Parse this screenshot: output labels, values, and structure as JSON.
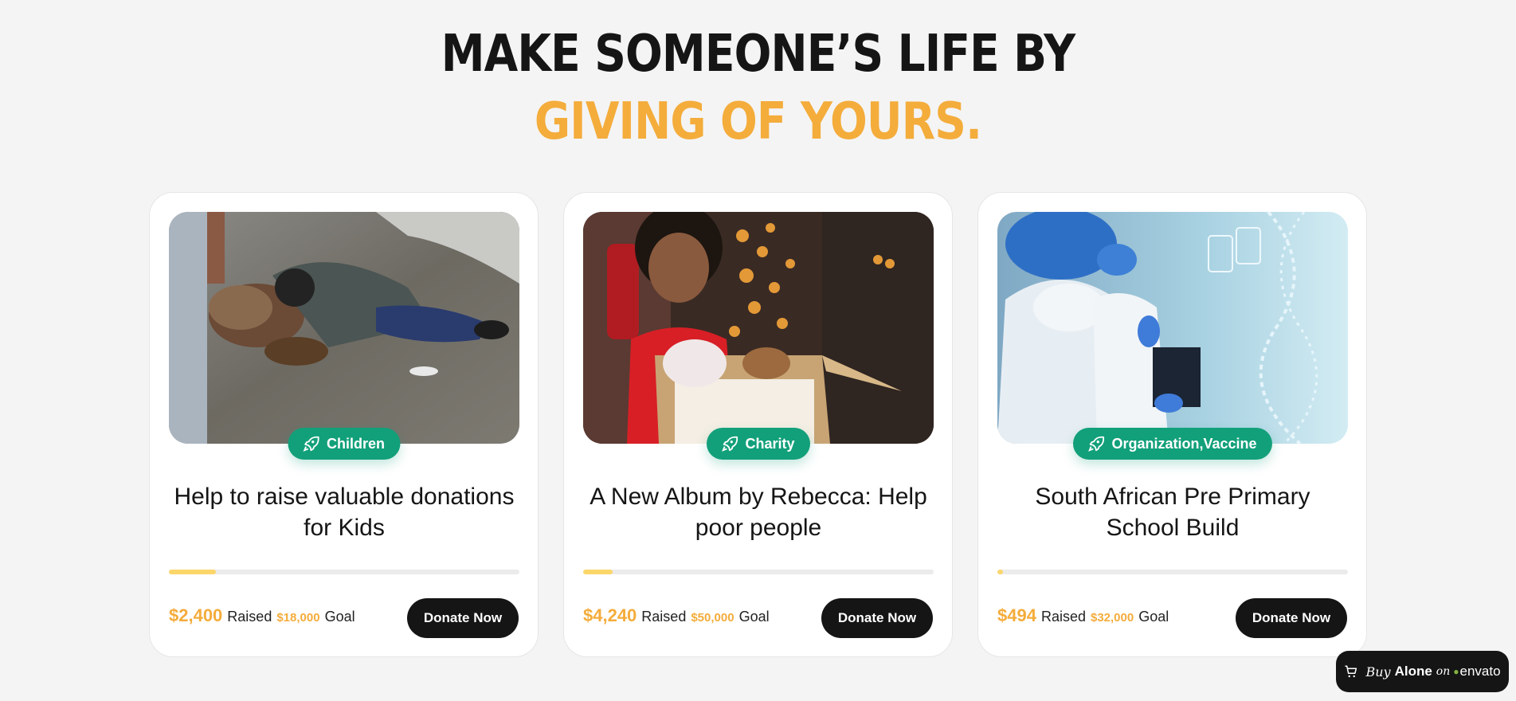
{
  "heading": {
    "line1": "MAKE SOMEONE’S LIFE BY",
    "line2": "GIVING OF YOURS."
  },
  "colors": {
    "accent": "#f4ac3b",
    "badge": "#12a07a",
    "progress_fill": "#fbd66a",
    "button": "#151515"
  },
  "cards": [
    {
      "category": "Children",
      "title": "Help to raise valuable donations for Kids",
      "raised": "$2,400",
      "raised_label": "Raised",
      "goal": "$18,000",
      "goal_label": "Goal",
      "progress_fraction": 0.133,
      "donate_label": "Donate Now",
      "badge_icon": "rocket-icon"
    },
    {
      "category": "Charity",
      "title": "A New Album by Rebecca: Help poor people",
      "raised": "$4,240",
      "raised_label": "Raised",
      "goal": "$50,000",
      "goal_label": "Goal",
      "progress_fraction": 0.085,
      "donate_label": "Donate Now",
      "badge_icon": "rocket-icon"
    },
    {
      "category": "Organization,Vaccine",
      "title": "South African Pre Primary School Build",
      "raised": "$494",
      "raised_label": "Raised",
      "goal": "$32,000",
      "goal_label": "Goal",
      "progress_fraction": 0.015,
      "donate_label": "Donate Now",
      "badge_icon": "rocket-icon"
    }
  ],
  "buy_alone": {
    "buy": "Buy",
    "alone": "Alone",
    "on": "on",
    "envato": "envato",
    "icon": "cart-icon"
  }
}
